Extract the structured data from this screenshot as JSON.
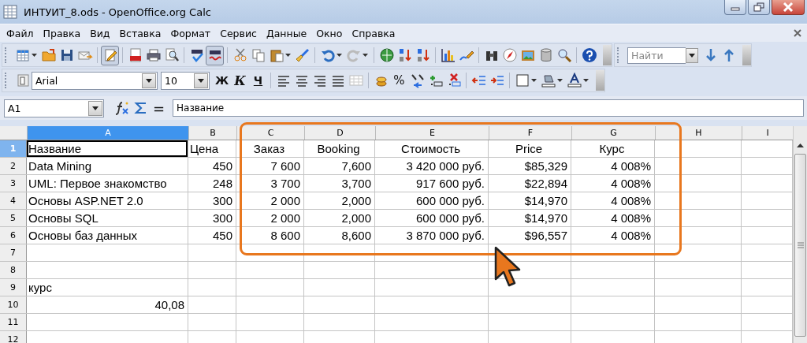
{
  "window": {
    "title": "ИНТУИТ_8.ods - OpenOffice.org Calc"
  },
  "menu": [
    {
      "label": "Файл"
    },
    {
      "label": "Правка"
    },
    {
      "label": "Вид"
    },
    {
      "label": "Вставка"
    },
    {
      "label": "Формат"
    },
    {
      "label": "Сервис"
    },
    {
      "label": "Данные"
    },
    {
      "label": "Окно"
    },
    {
      "label": "Справка"
    }
  ],
  "find": {
    "placeholder": "Найти"
  },
  "font_name": "Arial",
  "font_size": "10",
  "style_buttons": [
    {
      "label": "Ж",
      "kind": "bold"
    },
    {
      "label": "К",
      "kind": "italic"
    },
    {
      "label": "Ч",
      "kind": "underline"
    }
  ],
  "percent_button": "%",
  "formula_bar": {
    "name_box": "A1",
    "equals": "=",
    "formula": "Название"
  },
  "columns": [
    {
      "label": "A",
      "selected": true
    },
    {
      "label": "B",
      "selected": false
    },
    {
      "label": "C",
      "selected": false
    },
    {
      "label": "D",
      "selected": false
    },
    {
      "label": "E",
      "selected": false
    },
    {
      "label": "F",
      "selected": false
    },
    {
      "label": "G",
      "selected": false
    },
    {
      "label": "H",
      "selected": false
    },
    {
      "label": "I",
      "selected": false
    }
  ],
  "rows": [
    {
      "label": "1",
      "selected": true,
      "cells": [
        {
          "text": "Название",
          "kind": "text",
          "selected": true
        },
        {
          "text": "Цена",
          "kind": "text",
          "selected": false
        },
        {
          "text": "Заказ",
          "kind": "heading",
          "selected": false
        },
        {
          "text": "Booking",
          "kind": "heading",
          "selected": false
        },
        {
          "text": "Стоимость",
          "kind": "heading",
          "selected": false
        },
        {
          "text": "Price",
          "kind": "heading",
          "selected": false
        },
        {
          "text": "Курс",
          "kind": "heading",
          "selected": false
        },
        null,
        null
      ]
    },
    {
      "label": "2",
      "selected": false,
      "cells": [
        {
          "text": "Data Mining",
          "kind": "text",
          "selected": false
        },
        {
          "text": "450",
          "kind": "number",
          "selected": false
        },
        {
          "text": "7 600",
          "kind": "number",
          "selected": false
        },
        {
          "text": "7,600",
          "kind": "number",
          "selected": false
        },
        {
          "text": "3 420 000 руб.",
          "kind": "number",
          "selected": false
        },
        {
          "text": "$85,329",
          "kind": "number",
          "selected": false
        },
        {
          "text": "4 008%",
          "kind": "number",
          "selected": false
        },
        null,
        null
      ]
    },
    {
      "label": "3",
      "selected": false,
      "cells": [
        {
          "text": "UML: Первое знакомство",
          "kind": "text",
          "selected": false
        },
        {
          "text": "248",
          "kind": "number",
          "selected": false
        },
        {
          "text": "3 700",
          "kind": "number",
          "selected": false
        },
        {
          "text": "3,700",
          "kind": "number",
          "selected": false
        },
        {
          "text": "917 600 руб.",
          "kind": "number",
          "selected": false
        },
        {
          "text": "$22,894",
          "kind": "number",
          "selected": false
        },
        {
          "text": "4 008%",
          "kind": "number",
          "selected": false
        },
        null,
        null
      ]
    },
    {
      "label": "4",
      "selected": false,
      "cells": [
        {
          "text": "Основы ASP.NET 2.0",
          "kind": "text",
          "selected": false
        },
        {
          "text": "300",
          "kind": "number",
          "selected": false
        },
        {
          "text": "2 000",
          "kind": "number",
          "selected": false
        },
        {
          "text": "2,000",
          "kind": "number",
          "selected": false
        },
        {
          "text": "600 000 руб.",
          "kind": "number",
          "selected": false
        },
        {
          "text": "$14,970",
          "kind": "number",
          "selected": false
        },
        {
          "text": "4 008%",
          "kind": "number",
          "selected": false
        },
        null,
        null
      ]
    },
    {
      "label": "5",
      "selected": false,
      "cells": [
        {
          "text": "Основы SQL",
          "kind": "text",
          "selected": false
        },
        {
          "text": "300",
          "kind": "number",
          "selected": false
        },
        {
          "text": "2 000",
          "kind": "number",
          "selected": false
        },
        {
          "text": "2,000",
          "kind": "number",
          "selected": false
        },
        {
          "text": "600 000 руб.",
          "kind": "number",
          "selected": false
        },
        {
          "text": "$14,970",
          "kind": "number",
          "selected": false
        },
        {
          "text": "4 008%",
          "kind": "number",
          "selected": false
        },
        null,
        null
      ]
    },
    {
      "label": "6",
      "selected": false,
      "cells": [
        {
          "text": "Основы баз данных",
          "kind": "text",
          "selected": false
        },
        {
          "text": "450",
          "kind": "number",
          "selected": false
        },
        {
          "text": "8 600",
          "kind": "number",
          "selected": false
        },
        {
          "text": "8,600",
          "kind": "number",
          "selected": false
        },
        {
          "text": "3 870 000 руб.",
          "kind": "number",
          "selected": false
        },
        {
          "text": "$96,557",
          "kind": "number",
          "selected": false
        },
        {
          "text": "4 008%",
          "kind": "number",
          "selected": false
        },
        null,
        null
      ]
    },
    {
      "label": "7",
      "selected": false,
      "cells": [
        null,
        null,
        null,
        null,
        null,
        null,
        null,
        null,
        null
      ]
    },
    {
      "label": "8",
      "selected": false,
      "cells": [
        null,
        null,
        null,
        null,
        null,
        null,
        null,
        null,
        null
      ]
    },
    {
      "label": "9",
      "selected": false,
      "cells": [
        {
          "text": "курс",
          "kind": "text",
          "selected": false
        },
        null,
        null,
        null,
        null,
        null,
        null,
        null,
        null
      ]
    },
    {
      "label": "10",
      "selected": false,
      "cells": [
        {
          "text": "40,08",
          "kind": "number",
          "selected": false
        },
        null,
        null,
        null,
        null,
        null,
        null,
        null,
        null
      ]
    },
    {
      "label": "11",
      "selected": false,
      "cells": [
        null,
        null,
        null,
        null,
        null,
        null,
        null,
        null,
        null
      ]
    },
    {
      "label": "12",
      "selected": false,
      "cells": [
        null,
        null,
        null,
        null,
        null,
        null,
        null,
        null,
        null
      ]
    }
  ]
}
